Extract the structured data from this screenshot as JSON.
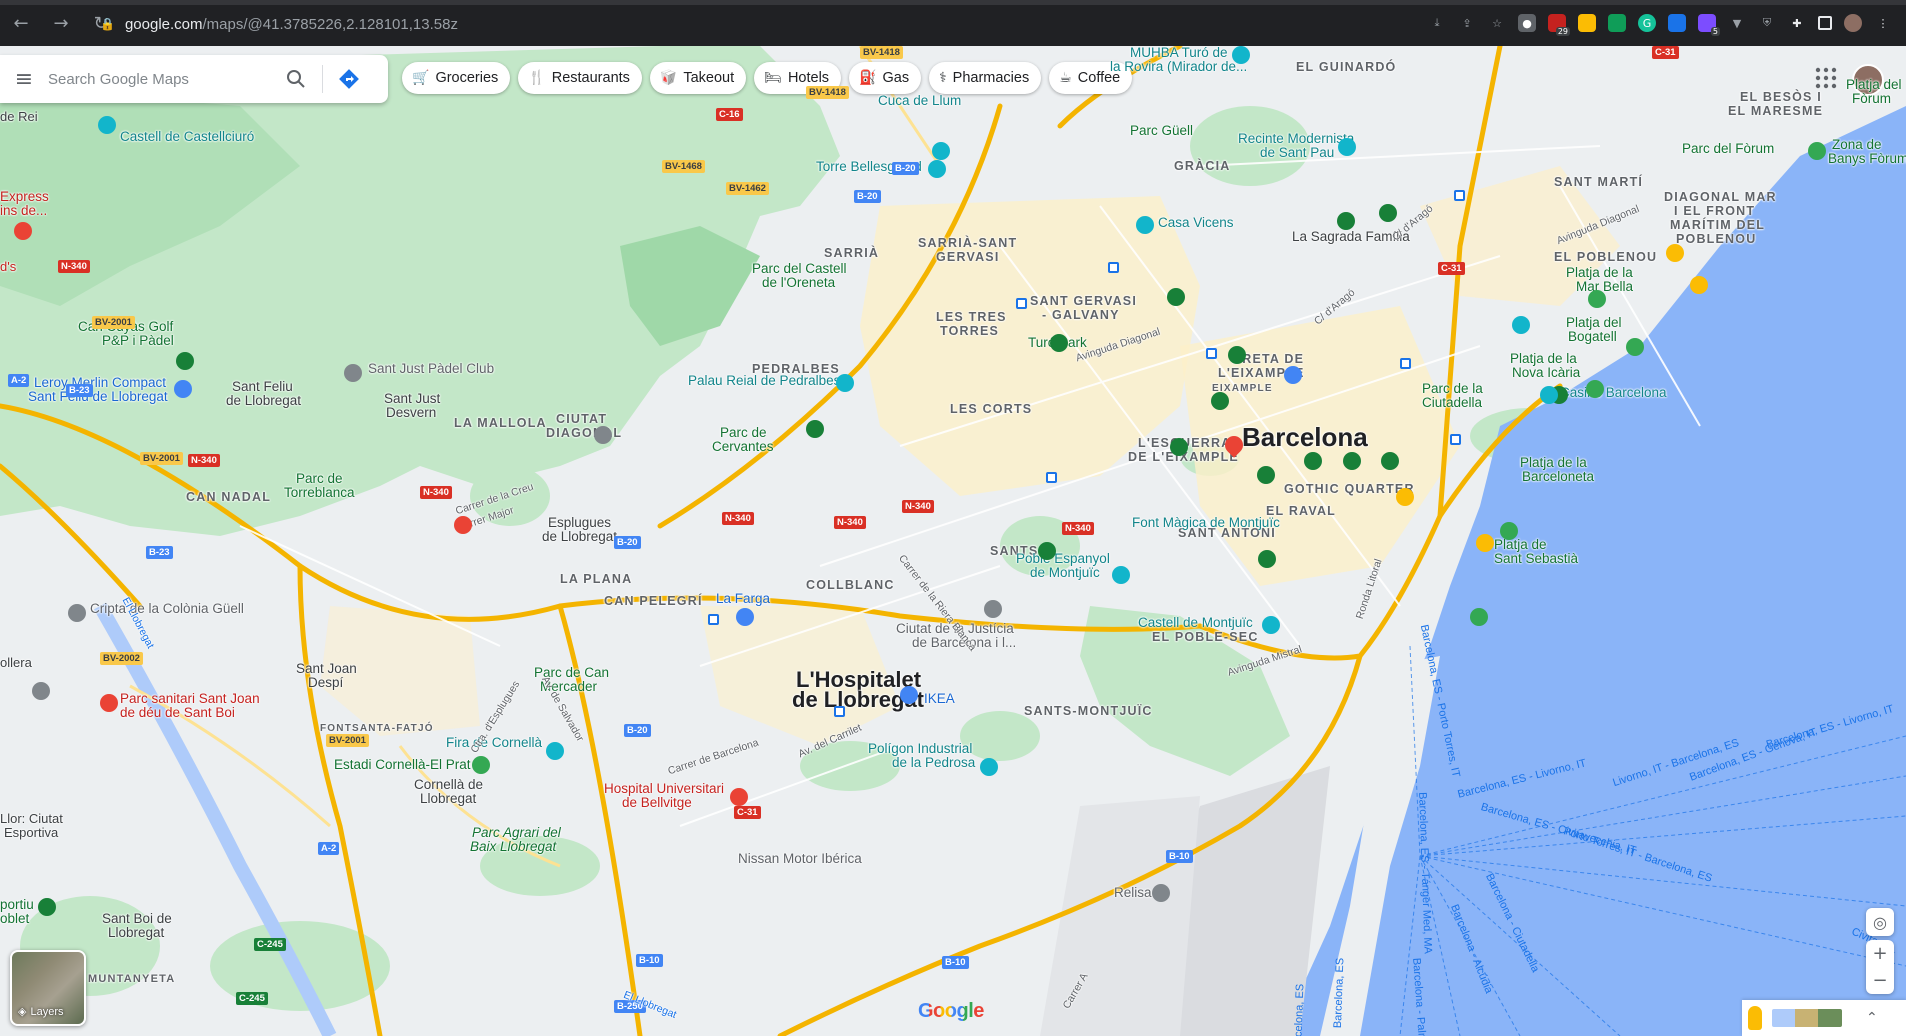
{
  "browser": {
    "url_host": "google.com",
    "url_path": "/maps/@41.3785226,2.128101,13.58z",
    "back_icon": "arrow-left-icon",
    "forward_icon": "arrow-right-icon",
    "reload_icon": "reload-icon",
    "badge_29": "29",
    "badge_5": "5"
  },
  "search": {
    "placeholder": "Search Google Maps"
  },
  "chips": [
    {
      "label": "Groceries",
      "icon": "cart-icon"
    },
    {
      "label": "Restaurants",
      "icon": "fork-knife-icon"
    },
    {
      "label": "Takeout",
      "icon": "takeout-icon"
    },
    {
      "label": "Hotels",
      "icon": "bed-icon"
    },
    {
      "label": "Gas",
      "icon": "fuel-icon"
    },
    {
      "label": "Pharmacies",
      "icon": "pharmacy-icon"
    },
    {
      "label": "Coffee",
      "icon": "coffee-icon"
    }
  ],
  "map": {
    "cities": {
      "barcelona": "Barcelona",
      "hospitalet_1": "L'Hospitalet",
      "hospitalet_2": "de Llobregat"
    },
    "districts": {
      "el_guinardo": "EL GUINARDÓ",
      "gracia": "GRÀCIA",
      "sant_marti": "SANT MARTÍ",
      "diagonal_mar_1": "DIAGONAL MAR",
      "diagonal_mar_2": "I EL FRONT",
      "diagonal_mar_3": "MARÍTIM DEL",
      "diagonal_mar_4": "POBLENOU",
      "el_poblenou": "EL POBLENOU",
      "sarria_sg_1": "SARRIÀ-SANT",
      "sarria_sg_2": "GERVASI",
      "sarria": "SARRIÀ",
      "sant_gervasi_1": "SANT GERVASI",
      "sant_gervasi_2": "- GALVANY",
      "tres_torres_1": "LES TRES",
      "tres_torres_2": "TORRES",
      "pedralbes": "PEDRALBES",
      "les_corts": "LES CORTS",
      "dreta_1": "DRETA DE",
      "dreta_2": "L'EIXAMPLE",
      "eixample": "EIXAMPLE",
      "esquerra_1": "L'ESQUERRA",
      "esquerra_2": "DE L'EIXAMPLE",
      "gothic": "GOTHIC QUARTER",
      "el_raval": "EL RAVAL",
      "sant_antoni": "SANT ANTONI",
      "sants": "SANTS",
      "collblanc": "COLLBLANC",
      "la_mallola": "LA MALLOLA",
      "ciutat_diagonal_1": "CIUTAT",
      "ciutat_diagonal_2": "DIAGONAL",
      "can_nadal": "CAN NADAL",
      "la_plana": "LA PLANA",
      "can_pelegri": "CAN PELEGRÍ",
      "el_poble_sec": "EL POBLE-SEC",
      "sants_montjuic": "SANTS-MONTJUÏC",
      "fontsanta": "FONTSANTA-FATJÓ",
      "muntanyeta": "MUNTANYETA"
    },
    "towns": {
      "sant_feliu_1": "Sant Feliu",
      "sant_feliu_2": "de Llobregat",
      "sant_just_1": "Sant Just",
      "sant_just_2": "Desvern",
      "esplugues_1": "Esplugues",
      "esplugues_2": "de Llobregat",
      "sant_joan_1": "Sant Joan",
      "sant_joan_2": "Despí",
      "cornella_1": "Cornellà de",
      "cornella_2": "Llobregat",
      "sant_boi_1": "Sant Boi de",
      "sant_boi_2": "Llobregat",
      "de_rei": "de Rei",
      "ds": "d's",
      "llor_1": "Llor: Ciutat",
      "llor_2": "Esportiva",
      "ollera": "ollera",
      "portiu_1": "portiu",
      "portiu_2": "oblet"
    },
    "pois": {
      "muhba_1": "MUHBA Turó de",
      "muhba_2": "la Rovira (Mirador de...",
      "cuca": "Cuca de Llum",
      "castell_castellciuro": "Castell de Castellciuró",
      "express_1": "Express",
      "express_2": "ins de...",
      "parc_guell": "Parc Güell",
      "recinte_1": "Recinte Modernista",
      "recinte_2": "de Sant Pau",
      "platja_forum_1": "Platja del",
      "platja_forum_2": "Fòrum",
      "besos_1": "EL BESÒS I",
      "besos_2": "EL MARESME",
      "parc_forum": "Parc del Fòrum",
      "zona_banys_1": "Zona de",
      "zona_banys_2": "Banys Fòrum",
      "torre_bellesguard": "Torre Bellesguard",
      "sagrada": "La Sagrada Família",
      "casa_vicens": "Casa Vicens",
      "castell_oreneta_1": "Parc del Castell",
      "castell_oreneta_2": "de l'Oreneta",
      "can_cuyas_1": "Can Cuyàs Golf",
      "can_cuyas_2": "P&P i Pàdel",
      "turo_park": "Turó Park",
      "platja_mar_bella_1": "Platja de la",
      "platja_mar_bella_2": "Mar Bella",
      "platja_bogatell_1": "Platja del",
      "platja_bogatell_2": "Bogatell",
      "sant_just_padel": "Sant Just Pàdel Club",
      "leroy_1": "Leroy Merlin Compact",
      "leroy_2": "Sant Feliu de Llobregat",
      "palau_pedralbes": "Palau Reial de Pedralbes",
      "platja_nova_icaria_1": "Platja de la",
      "platja_nova_icaria_2": "Nova Icària",
      "parc_ciutadella_1": "Parc de la",
      "parc_ciutadella_2": "Ciutadella",
      "casino": "Casino Barcelona",
      "parc_cervantes_1": "Parc de",
      "parc_cervantes_2": "Cervantes",
      "parc_torreblanca_1": "Parc de",
      "parc_torreblanca_2": "Torreblanca",
      "platja_barceloneta_1": "Platja de la",
      "platja_barceloneta_2": "Barceloneta",
      "font_magica": "Font Màgica de Montjuïc",
      "platja_sebastia_1": "Platja de",
      "platja_sebastia_2": "Sant Sebastià",
      "poble_espanyol_1": "Poble Espanyol",
      "poble_espanyol_2": "de Montjuïc",
      "la_farga": "La Farga",
      "castell_montjuic": "Castell de Montjuïc",
      "cripta": "Cripta de la Colònia Güell",
      "ciutat_justicia_1": "Ciutat de la Justícia",
      "ciutat_justicia_2": "de Barcelona i l...",
      "parc_can_mercader_1": "Parc de Can",
      "parc_can_mercader_2": "Mercader",
      "parc_sanitari_1": "Parc sanitari Sant Joan",
      "parc_sanitari_2": "de déu de Sant Boi",
      "ikea": "IKEA",
      "fira_cornella": "Fira de Cornellà",
      "estadi_cornella": "Estadi Cornellà-El Prat",
      "poligon_1": "Polígon Industrial",
      "poligon_2": "de la Pedrosa",
      "bellvitge_1": "Hospital Universitari",
      "bellvitge_2": "de Bellvitge",
      "parc_agrari_1": "Parc Agrari del",
      "parc_agrari_2": "Baix Llobregat",
      "nissan": "Nissan Motor Ibérica",
      "relisa": "Relisa"
    },
    "roads": {
      "bv1418_a": "BV-1418",
      "bv1418_b": "BV-1418",
      "c16": "C-16",
      "bv1468": "BV-1468",
      "bv1462": "BV-1462",
      "b20_a": "B-20",
      "b20_b": "B-20",
      "b20_c": "B-20",
      "b20_d": "B-20",
      "c31_a": "C-31",
      "c31_b": "C-31",
      "c31_c": "C-31",
      "n340_a": "N-340",
      "n340_b": "N-340",
      "n340_c": "N-340",
      "n340_d": "N-340",
      "n340_e": "N-340",
      "n340_f": "N-340",
      "n340_g": "N-340",
      "bv2001_a": "BV-2001",
      "bv2001_b": "BV-2001",
      "bv2001_c": "BV-2001",
      "bv2002": "BV-2002",
      "a2_a": "A-2",
      "a2_b": "A-2",
      "b23_a": "B-23",
      "b23_b": "B-23",
      "c245_a": "C-245",
      "c245_b": "C-245",
      "b10_a": "B-10",
      "b10_b": "B-10",
      "b10_c": "B-10",
      "b250": "B-250",
      "av_diagonal_a": "Avinguda Diagonal",
      "av_diagonal_b": "Avinguda Diagonal",
      "c_arago_a": "C/ d'Aragó",
      "c_arago_b": "C/ d'Aragó",
      "ronda_litoral": "Ronda Litoral",
      "av_mistral": "Avinguda Mistral",
      "carrer_creu": "Carrer de la Creu",
      "carrer_major": "Carrer Major",
      "carrer_riera": "Carrer de la Riera Blanca",
      "carrer_barcelona": "Carrer de Barcelona",
      "av_carrilet": "Av. del Carrilet",
      "el_llobregat_a": "El Llobregat",
      "el_llobregat_b": "El Llobregat",
      "ctra_esplugues": "Ctra. d'Esplugues",
      "av_salvador": "Av. de Salvador",
      "carrer_a": "Carrer A"
    },
    "sea_routes": {
      "r1": "Barcelona, ES - Génova, IT",
      "r2": "Barcelona, ES - Livorno, IT",
      "r3": "Livorno, IT - Barcelona, ES",
      "r4": "Barcelona, ES - Livorno, IT",
      "r5": "Barcelona, ES - Civitavecchia, IT",
      "r6": "Porto Torres, IT - Barcelona, ES",
      "r7": "Civitave...",
      "r8": "Barcelona, ES - Porto Torres, IT",
      "r9": "Barcelona, ES - Tánger Med, MA",
      "r10": "Barcelona - Ciutadella",
      "r11": "Barcelona - Alcúdia",
      "r12": "Barcelona - Palma",
      "r13": "Barcelona, ES",
      "r14": "Barcelona, ES"
    }
  },
  "controls": {
    "layers_label": "Layers",
    "google_logo": "Google"
  },
  "colors": {
    "park": "#c3e7c8",
    "park_dark": "#9fd8a8",
    "water": "#8ab4f8",
    "highway": "#fcd34d",
    "highway_casing": "#f4b400",
    "urban": "#fdf0c9",
    "land": "#eceff1"
  }
}
